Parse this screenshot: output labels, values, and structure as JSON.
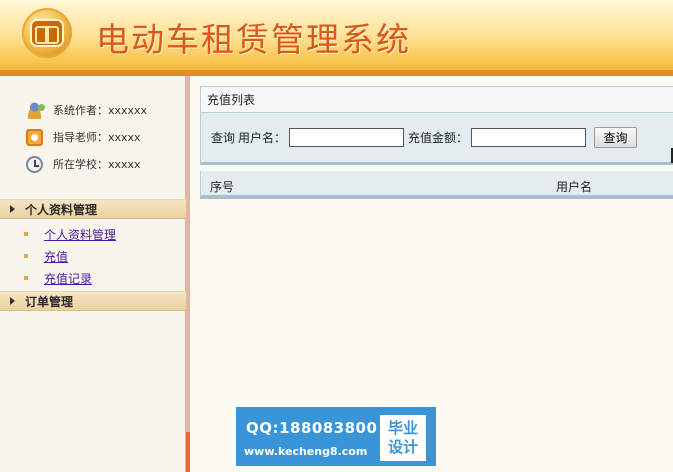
{
  "header": {
    "title": "电动车租赁管理系统"
  },
  "sidebar": {
    "info": [
      {
        "label": "系统作者：xxxxxx",
        "icon": "author-icon"
      },
      {
        "label": "指导老师：xxxxx",
        "icon": "teacher-icon"
      },
      {
        "label": "所在学校：xxxxx",
        "icon": "school-icon"
      }
    ],
    "groups": [
      {
        "title": "个人资料管理",
        "items": [
          "个人资料管理",
          "充值",
          "充值记录"
        ]
      },
      {
        "title": "订单管理",
        "items": []
      }
    ]
  },
  "main": {
    "panel_title": "充值列表",
    "search": {
      "prefix": "查询",
      "username_label": "用户名：",
      "amount_label": "充值金额：",
      "username_value": "",
      "amount_value": "",
      "query_button": "查询"
    },
    "table": {
      "columns": [
        "序号",
        "用户名"
      ]
    }
  },
  "watermark": {
    "qq": "QQ:188083800",
    "url": "www.kecheng8.com",
    "badge_line1": "毕业",
    "badge_line2": "设计"
  }
}
